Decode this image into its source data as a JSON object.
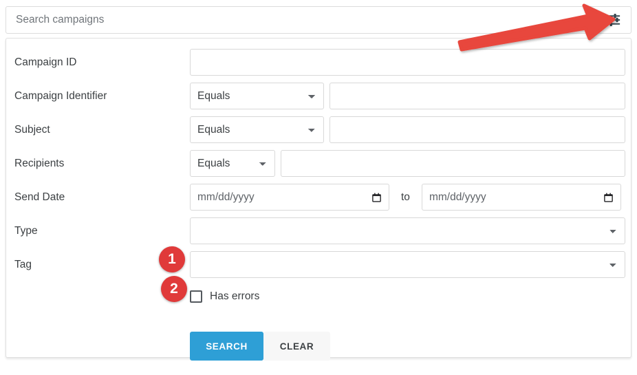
{
  "search": {
    "placeholder": "Search campaigns",
    "value": "",
    "filter_icon": "tune-icon"
  },
  "form": {
    "rows": [
      {
        "label": "Campaign ID",
        "type": "text",
        "value": "",
        "placeholder": ""
      },
      {
        "label": "Campaign Identifier",
        "type": "operator-text",
        "operator": "Equals",
        "operator_options": [
          "Equals"
        ],
        "value": "",
        "placeholder": ""
      },
      {
        "label": "Subject",
        "type": "operator-text",
        "operator": "Equals",
        "operator_options": [
          "Equals"
        ],
        "value": "",
        "placeholder": ""
      },
      {
        "label": "Recipients",
        "type": "operator-text-small",
        "operator": "Equals",
        "operator_options": [
          "Equals"
        ],
        "value": "",
        "placeholder": ""
      },
      {
        "label": "Send Date",
        "type": "date-range",
        "from_placeholder": "mm/dd/yyyy",
        "from_value": "",
        "separator": "to",
        "to_placeholder": "mm/dd/yyyy",
        "to_value": ""
      },
      {
        "label": "Type",
        "type": "select",
        "value": "",
        "options": [
          ""
        ]
      },
      {
        "label": "Tag",
        "type": "select",
        "value": "",
        "options": [
          ""
        ]
      }
    ],
    "checkbox": {
      "label": "Has errors",
      "checked": false
    },
    "buttons": {
      "search_label": "SEARCH",
      "clear_label": "CLEAR"
    }
  },
  "annotations": {
    "arrow_color": "#e8463c",
    "badge_color": "#e03a3a",
    "badges": [
      {
        "number": "1"
      },
      {
        "number": "2"
      }
    ]
  },
  "colors": {
    "accent_blue": "#2e9fd6",
    "text": "#3c4043",
    "placeholder": "#70757a",
    "border": "#d8d8d8"
  }
}
